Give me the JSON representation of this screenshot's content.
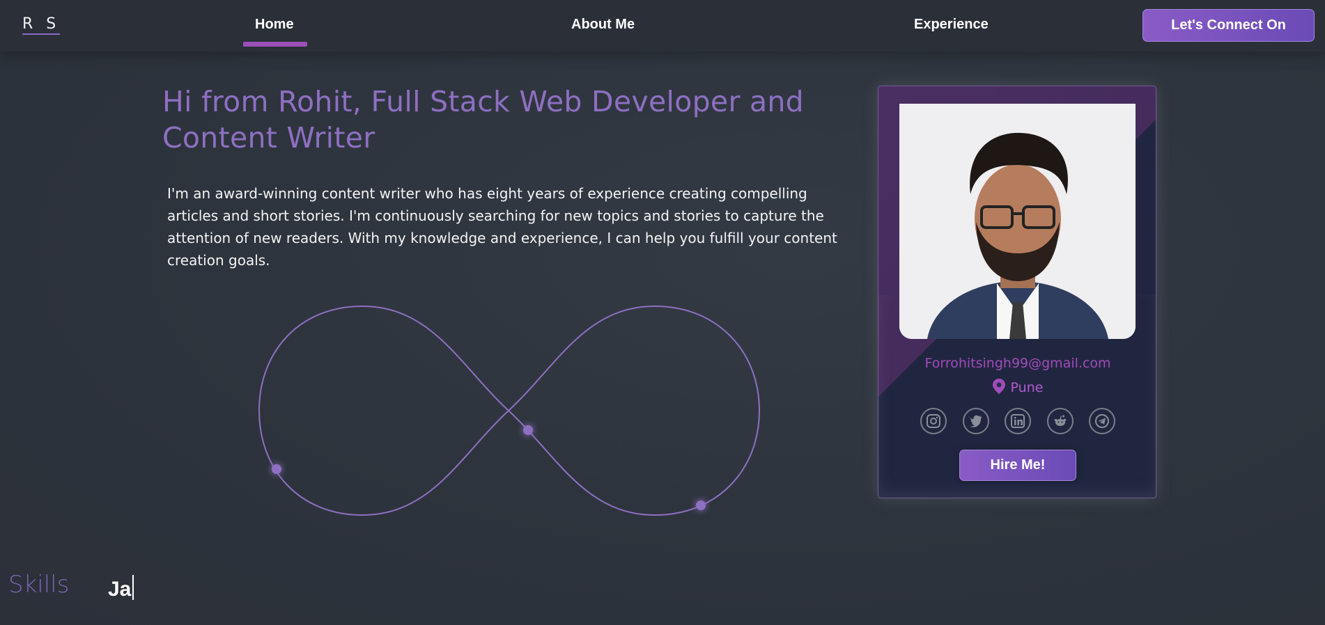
{
  "nav": {
    "logo": "R S",
    "links": [
      {
        "label": "Home",
        "active": true
      },
      {
        "label": "About Me",
        "active": false
      },
      {
        "label": "Experience",
        "active": false
      }
    ],
    "cta_label": "Let's Connect On"
  },
  "hero": {
    "title": "Hi from Rohit, Full Stack Web Developer and Content Writer",
    "description": "I'm an award-winning content writer who has eight years of experience creating compelling articles and short stories. I'm continuously searching for new topics and stories to capture the attention of new readers. With my knowledge and experience, I can help you fulfill your content creation goals."
  },
  "card": {
    "email": "Forrohitsingh99@gmail.com",
    "location": "Pune",
    "socials": [
      "instagram-icon",
      "twitter-icon",
      "linkedin-icon",
      "reddit-icon",
      "telegram-icon"
    ],
    "hire_label": "Hire Me!"
  },
  "skills": {
    "label": "Skills",
    "typed": "Ja"
  },
  "colors": {
    "accent": "#8e6fc2",
    "button": "#7a55c0",
    "background": "#2e343e"
  }
}
